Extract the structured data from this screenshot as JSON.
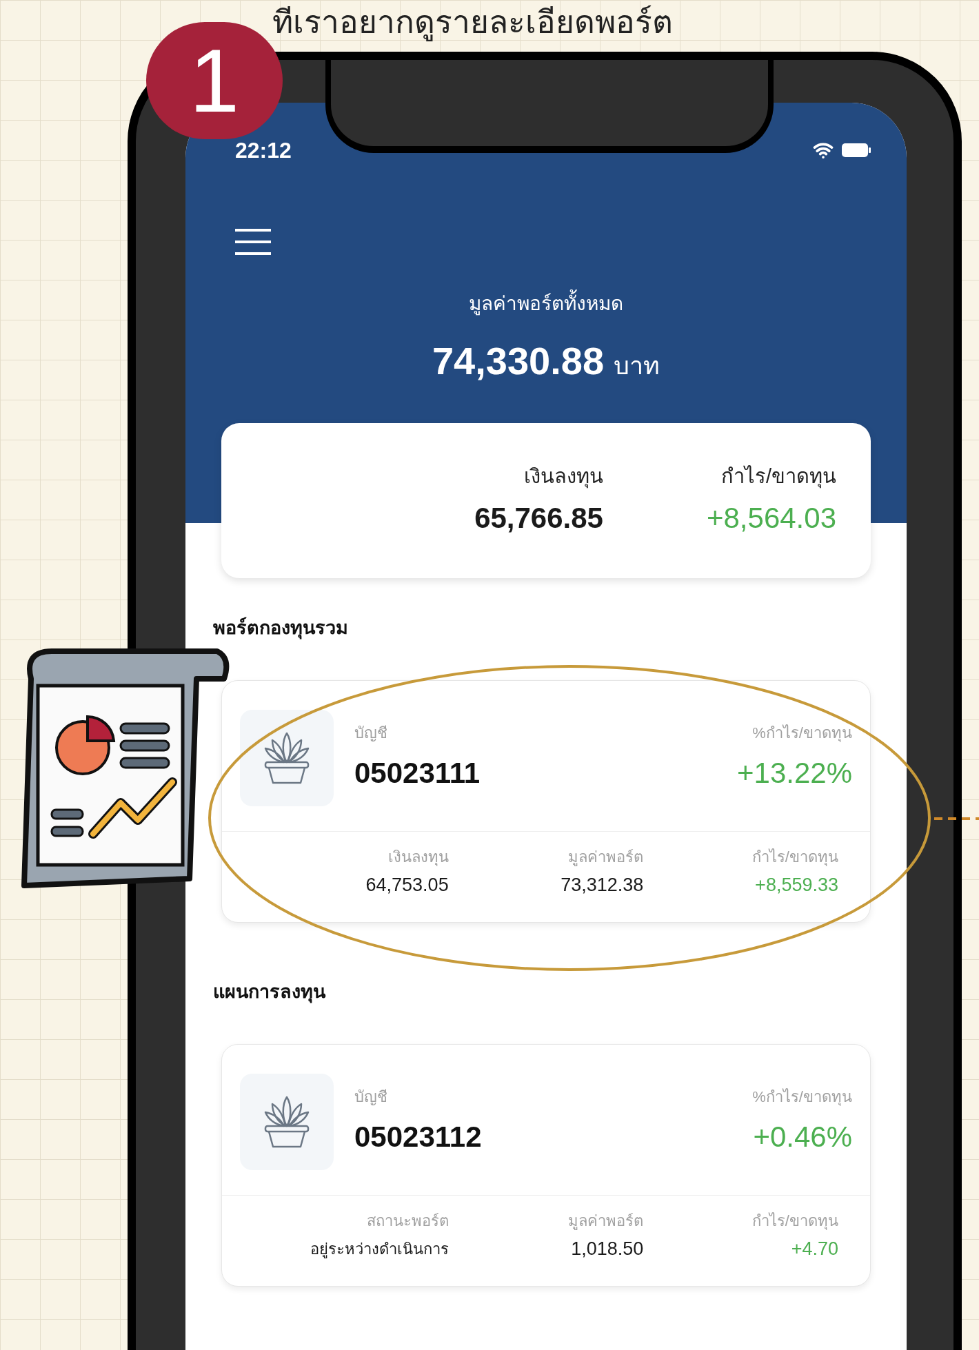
{
  "caption": "ทีเราอยากดูรายละเอียดพอร์ต",
  "step_badge": "1",
  "status_bar": {
    "time": "22:12"
  },
  "header": {
    "title": "มูลค่าพอร์ตทั้งหมด",
    "total": "74,330.88",
    "currency": "บาท"
  },
  "summary": [
    {
      "label": "เงินลงทุน",
      "value": "65,766.85",
      "color": "#1a1a1a"
    },
    {
      "label": "กำไร/ขาดทุน",
      "value": "+8,564.03",
      "color": "#4caf50"
    }
  ],
  "sections": [
    {
      "title": "พอร์ตกองทุนรวม",
      "highlighted": true,
      "card": {
        "account_label": "บัญชี",
        "account": "05023111",
        "percent": {
          "label": "%กำไร/ขาดทุน",
          "value": "+13.22%",
          "color": "#4caf50"
        },
        "stats": [
          {
            "label": "เงินลงทุน",
            "value": "64,753.05",
            "color": "#1a1a1a"
          },
          {
            "label": "มูลค่าพอร์ต",
            "value": "73,312.38",
            "color": "#1a1a1a"
          },
          {
            "label": "กำไร/ขาดทุน",
            "value": "+8,559.33",
            "color": "#4caf50"
          }
        ]
      }
    },
    {
      "title": "แผนการลงทุน",
      "highlighted": false,
      "card": {
        "account_label": "บัญชี",
        "account": "05023112",
        "percent": {
          "label": "%กำไร/ขาดทุน",
          "value": "+0.46%",
          "color": "#4caf50"
        },
        "stats": [
          {
            "label": "สถานะพอร์ต",
            "value": "อยู่ระหว่างดำเนินการ",
            "color": "#1a1a1a"
          },
          {
            "label": "มูลค่าพอร์ต",
            "value": "1,018.50",
            "color": "#1a1a1a"
          },
          {
            "label": "กำไร/ขาดทุน",
            "value": "+4.70",
            "color": "#4caf50"
          }
        ]
      }
    }
  ]
}
